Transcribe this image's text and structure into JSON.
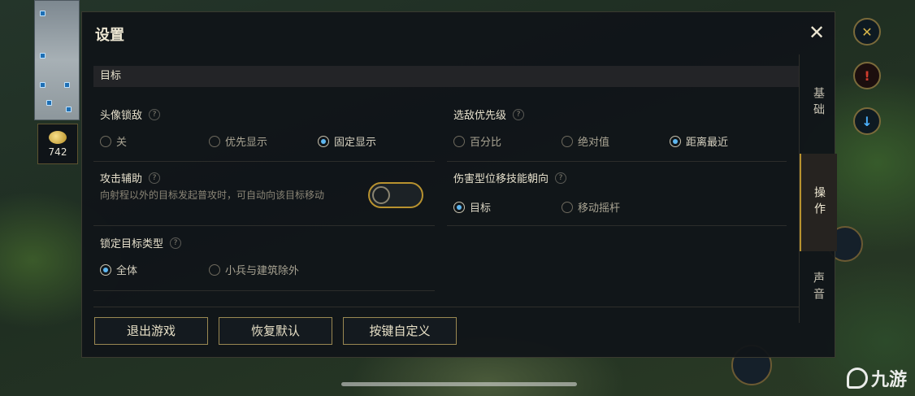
{
  "hud": {
    "gold": "742",
    "watermark": "九游"
  },
  "settings": {
    "title": "设置",
    "close_label": "✕",
    "section_title": "目标",
    "head_lock": {
      "label": "头像锁敌",
      "help": "?",
      "options": [
        "关",
        "优先显示",
        "固定显示"
      ],
      "selected": 2
    },
    "enemy_priority": {
      "label": "选敌优先级",
      "help": "?",
      "options": [
        "百分比",
        "绝对值",
        "距离最近"
      ],
      "selected": 2
    },
    "attack_assist": {
      "label": "攻击辅助",
      "help": "?",
      "description": "向射程以外的目标发起普攻时，可自动向该目标移动",
      "enabled": false
    },
    "dash_direction": {
      "label": "伤害型位移技能朝向",
      "help": "?",
      "options": [
        "目标",
        "移动摇杆"
      ],
      "selected": 0
    },
    "lock_target_type": {
      "label": "锁定目标类型",
      "help": "?",
      "options": [
        "全体",
        "小兵与建筑除外"
      ],
      "selected": 0
    },
    "buttons": {
      "quit": "退出游戏",
      "reset": "恢复默认",
      "custom_keys": "按键自定义"
    },
    "tabs": [
      "基础",
      "操作",
      "声音"
    ],
    "active_tab": 1
  }
}
